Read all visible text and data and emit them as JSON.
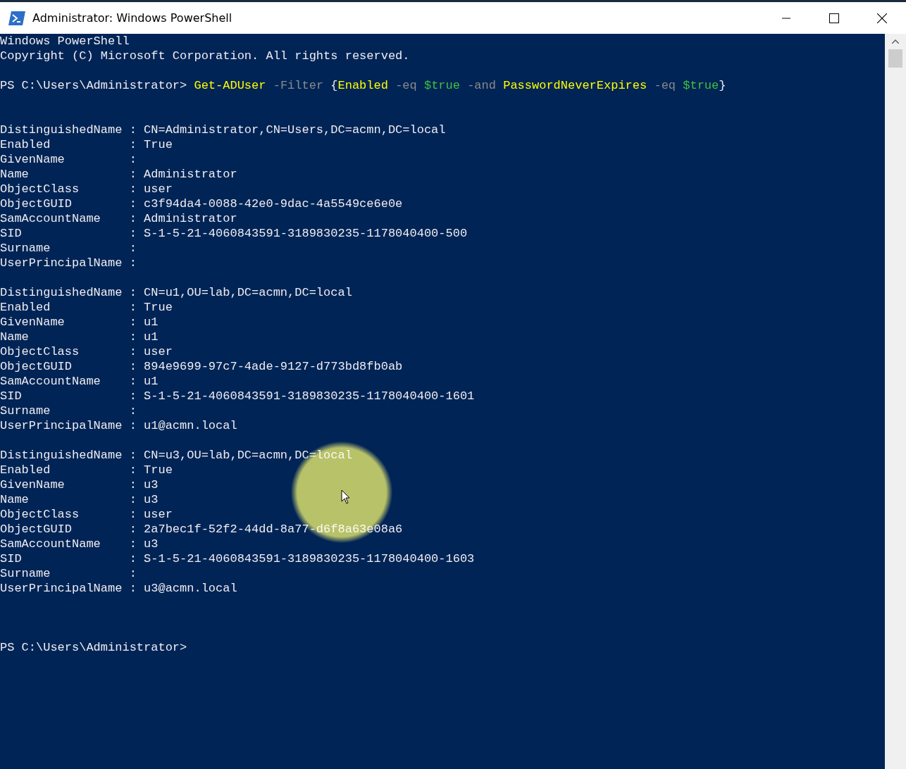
{
  "window": {
    "title": "Administrator: Windows PowerShell"
  },
  "banner": [
    "Windows PowerShell",
    "Copyright (C) Microsoft Corporation. All rights reserved."
  ],
  "command": {
    "prompt": "PS C:\\Users\\Administrator>",
    "tokens": [
      {
        "kind": "cmdlet",
        "text": "Get-ADUser"
      },
      {
        "kind": "parameter",
        "text": "-Filter"
      },
      {
        "kind": "plain",
        "text": "{"
      },
      {
        "kind": "word",
        "text": "Enabled"
      },
      {
        "kind": "parameter",
        "text": "-eq"
      },
      {
        "kind": "variable",
        "text": "$true"
      },
      {
        "kind": "parameter",
        "text": "-and"
      },
      {
        "kind": "word",
        "text": "PasswordNeverExpires"
      },
      {
        "kind": "parameter",
        "text": "-eq"
      },
      {
        "kind": "variable",
        "text": "$true"
      },
      {
        "kind": "plain",
        "text": "}"
      }
    ]
  },
  "separator": ":",
  "records": [
    {
      "fields": [
        {
          "name": "DistinguishedName",
          "value": "CN=Administrator,CN=Users,DC=acmn,DC=local"
        },
        {
          "name": "Enabled",
          "value": "True"
        },
        {
          "name": "GivenName"
        },
        {
          "name": "Name",
          "value": "Administrator"
        },
        {
          "name": "ObjectClass",
          "value": "user"
        },
        {
          "name": "ObjectGUID",
          "value": "c3f94da4-0088-42e0-9dac-4a5549ce6e0e"
        },
        {
          "name": "SamAccountName",
          "value": "Administrator"
        },
        {
          "name": "SID",
          "value": "S-1-5-21-4060843591-3189830235-1178040400-500"
        },
        {
          "name": "Surname"
        },
        {
          "name": "UserPrincipalName"
        }
      ]
    },
    {
      "fields": [
        {
          "name": "DistinguishedName",
          "value": "CN=u1,OU=lab,DC=acmn,DC=local"
        },
        {
          "name": "Enabled",
          "value": "True"
        },
        {
          "name": "GivenName",
          "value": "u1"
        },
        {
          "name": "Name",
          "value": "u1"
        },
        {
          "name": "ObjectClass",
          "value": "user"
        },
        {
          "name": "ObjectGUID",
          "value": "894e9699-97c7-4ade-9127-d773bd8fb0ab"
        },
        {
          "name": "SamAccountName",
          "value": "u1"
        },
        {
          "name": "SID",
          "value": "S-1-5-21-4060843591-3189830235-1178040400-1601"
        },
        {
          "name": "Surname"
        },
        {
          "name": "UserPrincipalName",
          "value": "u1@acmn.local"
        }
      ]
    },
    {
      "fields": [
        {
          "name": "DistinguishedName",
          "value": "CN=u3,OU=lab,DC=acmn,DC=local"
        },
        {
          "name": "Enabled",
          "value": "True"
        },
        {
          "name": "GivenName",
          "value": "u3"
        },
        {
          "name": "Name",
          "value": "u3"
        },
        {
          "name": "ObjectClass",
          "value": "user"
        },
        {
          "name": "ObjectGUID",
          "value": "2a7bec1f-52f2-44dd-8a77-d6f8a63e08a6"
        },
        {
          "name": "SamAccountName",
          "value": "u3"
        },
        {
          "name": "SID",
          "value": "S-1-5-21-4060843591-3189830235-1178040400-1603"
        },
        {
          "name": "Surname"
        },
        {
          "name": "UserPrincipalName",
          "value": "u3@acmn.local"
        }
      ]
    }
  ],
  "final_prompt": "PS C:\\Users\\Administrator>"
}
